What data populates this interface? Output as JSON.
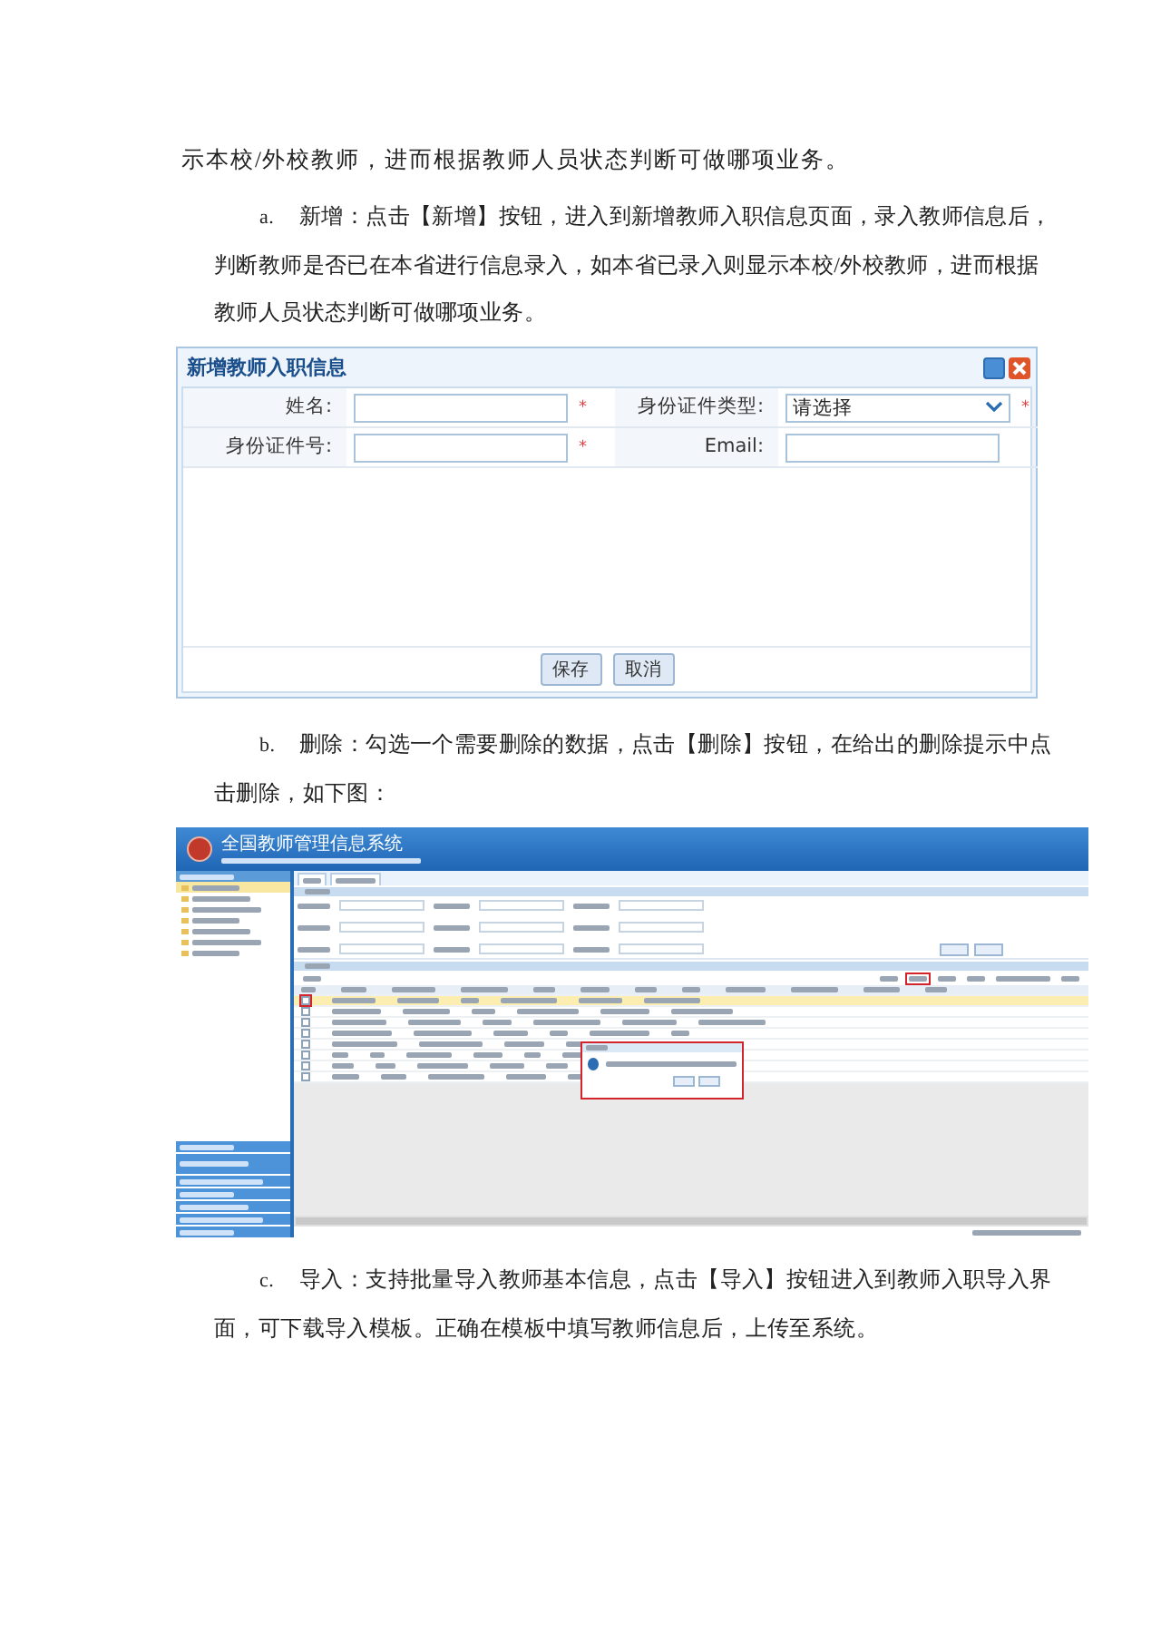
{
  "blocks": [
    {
      "kind": "paragraph",
      "text": "示本校/外校教师，进而根据教师人员状态判断可做哪项业务。"
    },
    {
      "kind": "list_item",
      "marker": "a.",
      "text": "新增：点击【新增】按钮，进入到新增教师入职信息页面，录入教师信息后，判断教师是否已在本省进行信息录入，如本省已录入则显示本校/外校教师，进而根据教师人员状态判断可做哪项业务。"
    },
    {
      "kind": "dialog",
      "title": "新增教师入职信息",
      "fields": [
        {
          "kind": "text",
          "label": "姓名:",
          "required_mark": "*"
        },
        {
          "kind": "select",
          "label": "身份证件类型:",
          "value": "请选择",
          "required_mark": "*"
        },
        {
          "kind": "text",
          "label": "身份证件号:",
          "required_mark": "*"
        },
        {
          "kind": "text",
          "label": "Email:"
        }
      ],
      "buttons": [
        "保存",
        "取消"
      ]
    },
    {
      "kind": "list_item",
      "marker": "b.",
      "text": "删除：勾选一个需要删除的数据，点击【删除】按钮，在给出的删除提示中点击删除，如下图："
    },
    {
      "kind": "screenshot",
      "title": "全国教师管理信息系统",
      "sidebar_items": [
        {
          "selected": true
        },
        {
          "selected": false
        },
        {
          "selected": false
        },
        {
          "selected": false
        },
        {
          "selected": false
        },
        {
          "selected": false
        },
        {
          "selected": false
        }
      ],
      "rows": [
        {
          "selected": true
        },
        {
          "selected": false
        },
        {
          "selected": false
        },
        {
          "selected": false
        },
        {
          "selected": false
        },
        {
          "selected": false
        },
        {
          "selected": false
        },
        {
          "selected": false
        }
      ]
    },
    {
      "kind": "list_item",
      "marker": "c.",
      "text": "导入：支持批量导入教师基本信息，点击【导入】按钮进入到教师入职导入界面，可下载导入模板。正确在模板中填写教师信息后，上传至系统。"
    }
  ]
}
